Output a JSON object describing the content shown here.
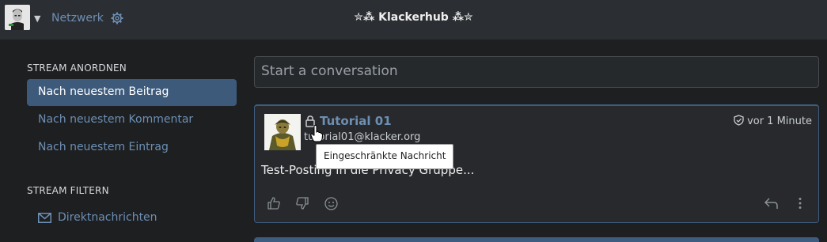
{
  "topbar": {
    "network_label": "Netzwerk",
    "site_title": "✮⁂ Klackerhub ⁂✮"
  },
  "sidebar": {
    "order_heading": "STREAM ANORDNEN",
    "order_items": [
      {
        "label": "Nach neuestem Beitrag",
        "active": true
      },
      {
        "label": "Nach neuestem Kommentar",
        "active": false
      },
      {
        "label": "Nach neuestem Eintrag",
        "active": false
      }
    ],
    "filter_heading": "STREAM FILTERN",
    "filter_items": [
      {
        "label": "Direktnachrichten",
        "icon": "envelope-icon"
      }
    ]
  },
  "composer": {
    "placeholder": "Start a conversation"
  },
  "post": {
    "author": "Tutorial 01",
    "handle": "tutorial01@klacker.org",
    "time": "vor 1 Minute",
    "body": "Test-Posting in die Privacy Gruppe...",
    "tooltip": "Eingeschränkte Nachricht"
  },
  "colors": {
    "accent": "#3d5a7b",
    "link": "#6d8fb4",
    "background": "#1d1f21",
    "topbar": "#2b2e32"
  }
}
